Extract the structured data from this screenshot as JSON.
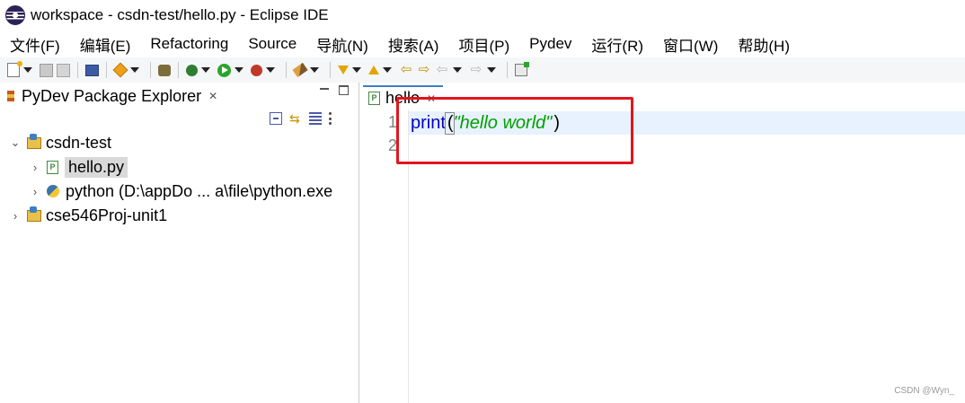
{
  "window": {
    "title": "workspace - csdn-test/hello.py - Eclipse IDE"
  },
  "menubar": {
    "items": [
      "文件(F)",
      "编辑(E)",
      "Refactoring",
      "Source",
      "导航(N)",
      "搜索(A)",
      "项目(P)",
      "Pydev",
      "运行(R)",
      "窗口(W)",
      "帮助(H)"
    ]
  },
  "toolbar": {
    "icons": [
      "new-file-icon",
      "save-icon",
      "save-all-icon",
      "console-icon",
      "package-icon",
      "gears-icon",
      "debug-icon",
      "run-icon",
      "external-tools-icon",
      "brush-icon",
      "next-annotation-icon",
      "previous-annotation-icon",
      "last-edit-icon",
      "back-icon",
      "forward-icon",
      "pin-editor-icon"
    ]
  },
  "left_panel": {
    "tab_label": "PyDev Package Explorer",
    "tree": [
      {
        "label": "csdn-test",
        "expanded": true
      },
      {
        "label": "hello.py",
        "selected": true
      },
      {
        "label": "python  (D:\\appDo ... a\\file\\python.exe"
      },
      {
        "label": "cse546Proj-unit1",
        "expanded": false
      }
    ]
  },
  "editor": {
    "tab_label": "hello",
    "lines": [
      {
        "number": "1",
        "keyword": "print",
        "open": "(",
        "string": "\"hello world\"",
        "close": ")"
      },
      {
        "number": "2"
      }
    ]
  },
  "watermark": "CSDN @Wyn_",
  "colors": {
    "keyword": "#0000c0",
    "string": "#00a000",
    "current_line": "#e8f2fe",
    "annotation_box": "#e3151c"
  }
}
